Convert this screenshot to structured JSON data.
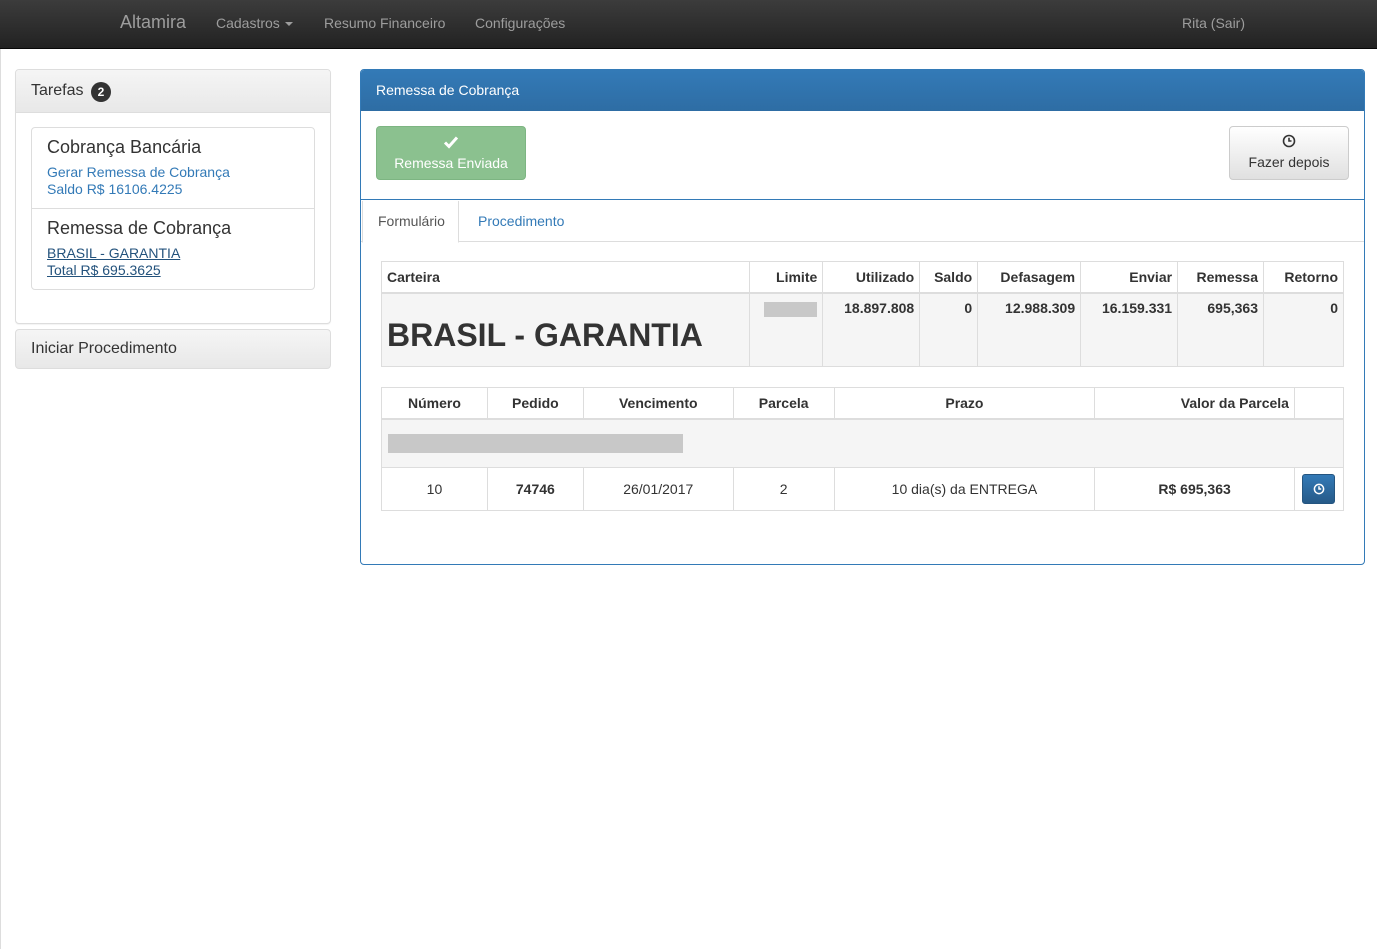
{
  "navbar": {
    "brand": "Altamira",
    "items": [
      "Cadastros",
      "Resumo Financeiro",
      "Configurações"
    ],
    "user": "Rita (Sair)"
  },
  "tasks": {
    "title": "Tarefas",
    "count": "2",
    "items": [
      {
        "title": "Cobrança Bancária",
        "line1": "Gerar Remessa de Cobrança",
        "line2": "Saldo R$ 16106.4225"
      },
      {
        "title": "Remessa de Cobrança",
        "line1": "BRASIL - GARANTIA",
        "line2": "Total R$ 695.3625"
      }
    ],
    "start_button": "Iniciar Procedimento"
  },
  "main": {
    "title": "Remessa de Cobrança",
    "sent_button": "Remessa Enviada",
    "later_button": "Fazer depois",
    "tabs": [
      "Formulário",
      "Procedimento"
    ],
    "summary": {
      "headers": [
        "Carteira",
        "Limite",
        "Utilizado",
        "Saldo",
        "Defasagem",
        "Enviar",
        "Remessa",
        "Retorno"
      ],
      "row": {
        "carteira": "BRASIL - GARANTIA",
        "utilizado": "18.897.808",
        "saldo": "0",
        "defasagem": "12.988.309",
        "enviar": "16.159.331",
        "remessa": "695,363",
        "retorno": "0"
      }
    },
    "parcelas": {
      "headers": [
        "Número",
        "Pedido",
        "Vencimento",
        "Parcela",
        "Prazo",
        "Valor da Parcela"
      ],
      "rows": [
        {
          "numero": "10",
          "pedido": "74746",
          "vencimento": "26/01/2017",
          "parcela": "2",
          "prazo": "10 dia(s) da ENTREGA",
          "valor": "R$ 695,363"
        }
      ]
    }
  },
  "colors": {
    "primary": "#337ab7",
    "success": "#8bc18f",
    "navbar": "#222222"
  },
  "icons": {
    "sent": "check-icon",
    "later": "clock-icon",
    "row_action": "clock-icon"
  }
}
